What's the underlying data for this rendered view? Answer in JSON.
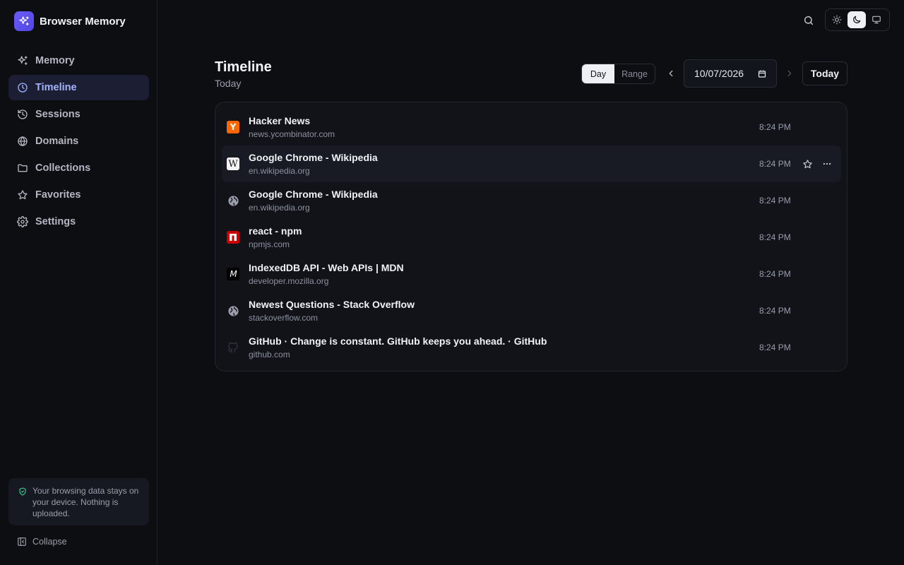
{
  "app": {
    "title": "Browser Memory"
  },
  "sidebar": {
    "items": [
      {
        "label": "Memory",
        "icon": "sparkles-icon"
      },
      {
        "label": "Timeline",
        "icon": "clock-icon",
        "active": true
      },
      {
        "label": "Sessions",
        "icon": "history-icon"
      },
      {
        "label": "Domains",
        "icon": "globe-icon"
      },
      {
        "label": "Collections",
        "icon": "folder-icon"
      },
      {
        "label": "Favorites",
        "icon": "star-icon"
      },
      {
        "label": "Settings",
        "icon": "gear-icon"
      }
    ],
    "privacy_note": "Your browsing data stays on your device. Nothing is uploaded.",
    "collapse_label": "Collapse"
  },
  "header": {
    "title": "Timeline",
    "subtitle": "Today",
    "mode": {
      "day_label": "Day",
      "range_label": "Range",
      "selected": "Day"
    },
    "date_value": "10/07/2026",
    "today_label": "Today"
  },
  "theme": {
    "options": [
      "light",
      "dark",
      "system"
    ],
    "selected": "dark"
  },
  "timeline": {
    "rows": [
      {
        "title": "Hacker News",
        "domain": "news.ycombinator.com",
        "time": "8:24 PM",
        "favicon": "hacker-news-icon"
      },
      {
        "title": "Google Chrome - Wikipedia",
        "domain": "en.wikipedia.org",
        "time": "8:24 PM",
        "favicon": "wikipedia-icon"
      },
      {
        "title": "Google Chrome - Wikipedia",
        "domain": "en.wikipedia.org",
        "time": "8:24 PM",
        "favicon": "globe-icon"
      },
      {
        "title": "react - npm",
        "domain": "npmjs.com",
        "time": "8:24 PM",
        "favicon": "npm-icon"
      },
      {
        "title": "IndexedDB API - Web APIs | MDN",
        "domain": "developer.mozilla.org",
        "time": "8:24 PM",
        "favicon": "mdn-icon"
      },
      {
        "title": "Newest Questions - Stack Overflow",
        "domain": "stackoverflow.com",
        "time": "8:24 PM",
        "favicon": "globe-icon"
      },
      {
        "title": "GitHub · Change is constant. GitHub keeps you ahead. · GitHub",
        "domain": "github.com",
        "time": "8:24 PM",
        "favicon": "github-icon"
      }
    ]
  },
  "colors": {
    "accent": "#a5b4fc",
    "brand": "#5b4ef0",
    "background": "#0d0e12",
    "privacy_icon": "#34d399"
  }
}
